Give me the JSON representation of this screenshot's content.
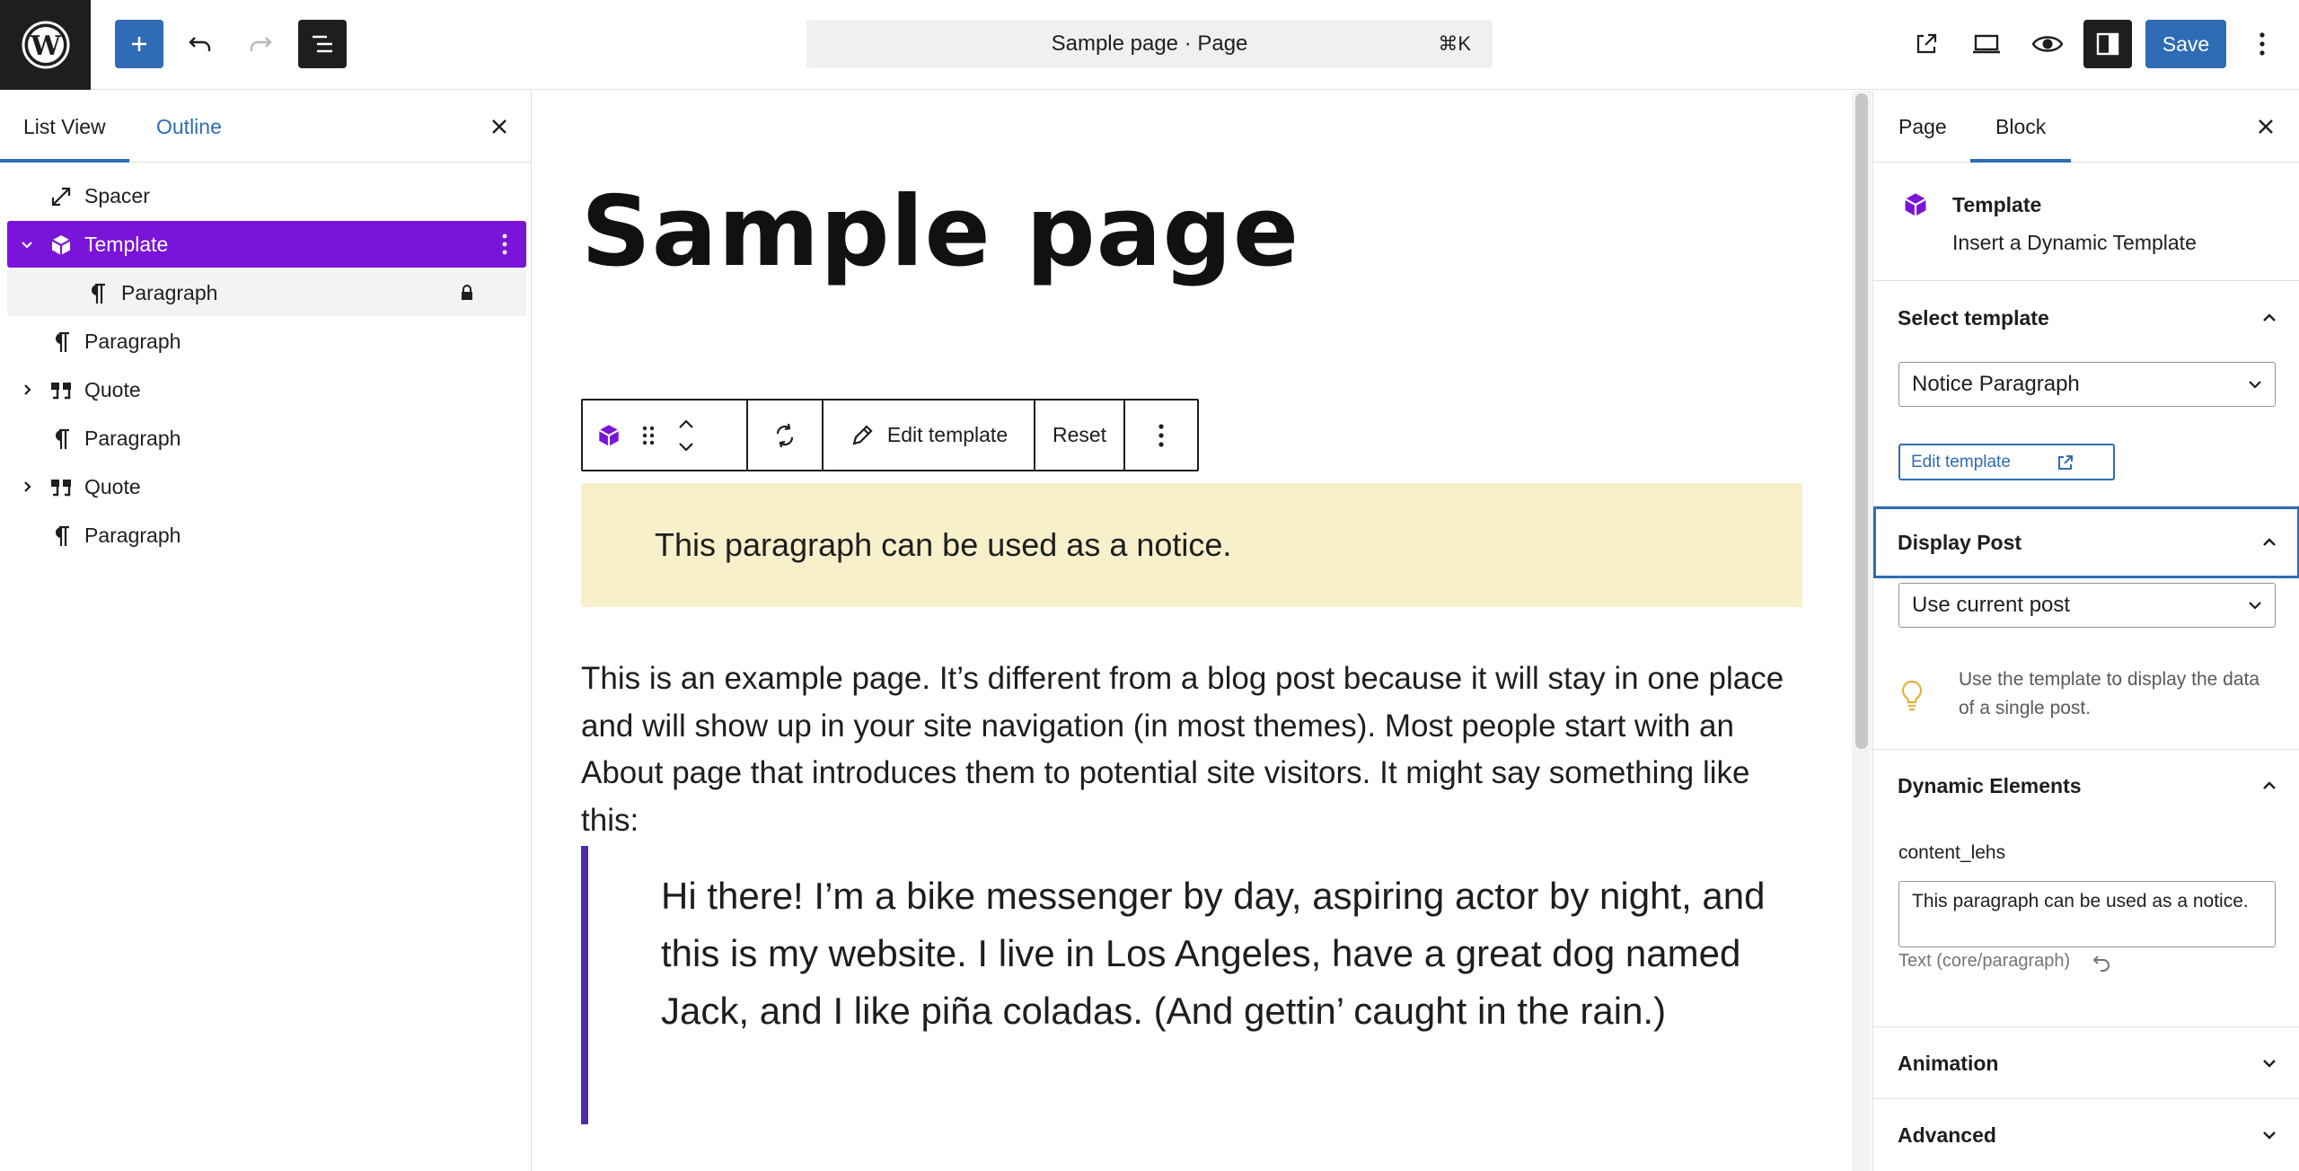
{
  "topbar": {
    "document_title": "Sample page · Page",
    "shortcut": "⌘K",
    "save_label": "Save"
  },
  "left_panel": {
    "tabs": [
      {
        "label": "List View",
        "active": true
      },
      {
        "label": "Outline",
        "active": false
      }
    ],
    "tree": [
      {
        "label": "Spacer",
        "icon": "resize-icon",
        "expandable": false
      },
      {
        "label": "Template",
        "icon": "cube-icon",
        "expandable": true,
        "expanded": true,
        "selected": true
      },
      {
        "label": "Paragraph",
        "icon": "paragraph-icon",
        "child": true,
        "locked": true
      },
      {
        "label": "Paragraph",
        "icon": "paragraph-icon"
      },
      {
        "label": "Quote",
        "icon": "quote-icon",
        "expandable": true,
        "expanded": false
      },
      {
        "label": "Paragraph",
        "icon": "paragraph-icon"
      },
      {
        "label": "Quote",
        "icon": "quote-icon",
        "expandable": true,
        "expanded": false
      },
      {
        "label": "Paragraph",
        "icon": "paragraph-icon"
      }
    ]
  },
  "canvas": {
    "title": "Sample page",
    "block_toolbar": {
      "edit_template_label": "Edit template",
      "reset_label": "Reset"
    },
    "notice_text": "This paragraph can be used as a notice.",
    "paragraph": "This is an example page. It’s different from a blog post because it will stay in one place and will show up in your site navigation (in most themes). Most people start with an About page that introduces them to potential site visitors. It might say something like this:",
    "quote": "Hi there! I’m a bike messenger by day, aspiring actor by night, and this is my website. I live in Los Angeles, have a great dog named Jack, and I like piña coladas. (And gettin’ caught in the rain.)"
  },
  "right_panel": {
    "tabs": [
      {
        "label": "Page",
        "active": false
      },
      {
        "label": "Block",
        "active": true
      }
    ],
    "block_card": {
      "title": "Template",
      "description": "Insert a Dynamic Template"
    },
    "select_template": {
      "heading": "Select template",
      "value": "Notice Paragraph",
      "edit_button": "Edit template"
    },
    "display_post": {
      "heading": "Display Post",
      "value": "Use current post",
      "tip": "Use the template to display the data of a single post."
    },
    "dynamic_elements": {
      "heading": "Dynamic Elements",
      "field_label": "content_lehs",
      "field_value": "This paragraph can be used as a notice.",
      "field_help": "Text (core/paragraph)"
    },
    "animation_heading": "Animation",
    "advanced_heading": "Advanced"
  },
  "colors": {
    "accent": "#2f6cb5",
    "selected_row": "#7a14d8",
    "notice_bg": "#f7f0cb",
    "quote_bar": "#4f2aa8"
  }
}
